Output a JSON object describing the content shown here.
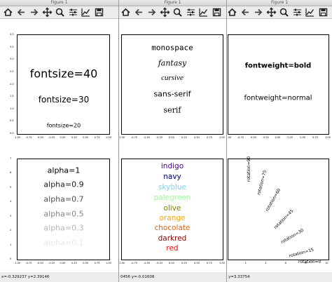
{
  "windows": [
    {
      "title": "Figure 1",
      "status": "x=-0.329237   y=2.39146"
    },
    {
      "title": "Figure 1",
      "status": "0456   y=-0.01608"
    },
    {
      "title": "Figure 1",
      "status": "y=3.33754"
    }
  ],
  "toolbar": {
    "icons": [
      "home-icon",
      "back-arrow-icon",
      "forward-arrow-icon",
      "pan-icon",
      "zoom-icon",
      "configure-subplots-icon",
      "edit-axes-icon",
      "save-icon"
    ]
  },
  "colors": {
    "close": "#fc5f57",
    "minimize": "#fdbc2e",
    "zoom": "#33c748"
  },
  "axes": {
    "x_ticks": [
      "-1.00",
      "-0.75",
      "-0.50",
      "-0.25",
      "0.00",
      "0.25",
      "0.50",
      "0.75",
      "1.00"
    ],
    "y_ticks": [
      "4.0",
      "3.5",
      "3.0",
      "2.5",
      "2.0",
      "1.5",
      "1.0",
      "0.5",
      "0.0"
    ],
    "y_ticks_bottom": [
      "7",
      "6",
      "5",
      "4",
      "3",
      "2",
      "1",
      "0"
    ],
    "x_ticks_right": [
      "0",
      "2",
      "4",
      "6",
      "8",
      "10"
    ]
  },
  "panels": {
    "fontsize": [
      {
        "text": "fontsize=40",
        "size": 40
      },
      {
        "text": "fontsize=30",
        "size": 30
      },
      {
        "text": "fontsize=20",
        "size": 20
      }
    ],
    "family": [
      {
        "text": "monospace",
        "family": "monospace"
      },
      {
        "text": "fantasy",
        "family": "fantasy"
      },
      {
        "text": "cursive",
        "family": "cursive"
      },
      {
        "text": "sans-serif",
        "family": "sans-serif"
      },
      {
        "text": "serif",
        "family": "serif"
      }
    ],
    "weight": [
      {
        "text": "fontweight=bold",
        "weight": "bold"
      },
      {
        "text": "fontweight=normal",
        "weight": "normal"
      }
    ],
    "alpha": [
      {
        "text": "alpha=1",
        "alpha": 1
      },
      {
        "text": "alpha=0.9",
        "alpha": 0.9
      },
      {
        "text": "alpha=0.7",
        "alpha": 0.7
      },
      {
        "text": "alpha=0.5",
        "alpha": 0.5
      },
      {
        "text": "alpha=0.3",
        "alpha": 0.3
      },
      {
        "text": "alpha=0.1",
        "alpha": 0.1
      }
    ],
    "colors": [
      {
        "text": "indigo",
        "color": "#4b0082"
      },
      {
        "text": "navy",
        "color": "#000080"
      },
      {
        "text": "skyblue",
        "color": "#87ceeb"
      },
      {
        "text": "palegreen",
        "color": "#98fb98"
      },
      {
        "text": "olive",
        "color": "#808000"
      },
      {
        "text": "orange",
        "color": "#ffa500"
      },
      {
        "text": "chocolate",
        "color": "#d2691e"
      },
      {
        "text": "darkred",
        "color": "#8b0000"
      },
      {
        "text": "red",
        "color": "#ff0000"
      }
    ],
    "rotation": [
      {
        "text": "rotation=90",
        "angle": 90
      },
      {
        "text": "rotation=75",
        "angle": 75
      },
      {
        "text": "rotation=60",
        "angle": 60
      },
      {
        "text": "rotation=45",
        "angle": 45
      },
      {
        "text": "rotation=30",
        "angle": 30
      },
      {
        "text": "rotation=15",
        "angle": 15
      },
      {
        "text": "rotation=0",
        "angle": 0
      }
    ]
  }
}
